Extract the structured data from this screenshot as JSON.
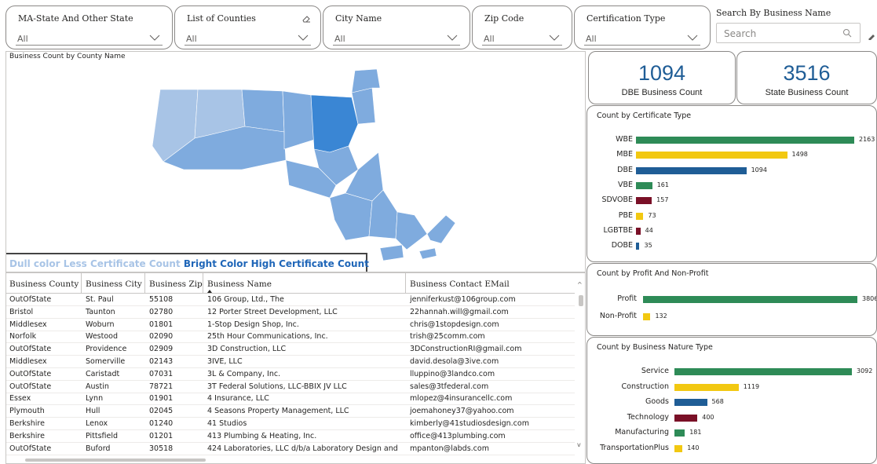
{
  "colors": {
    "green": "#2e8b57",
    "yellow": "#f2c811",
    "blue": "#1f5d96",
    "maroon": "#7a1027",
    "map_dull": "#a8c4e6",
    "map_mid": "#7fabde",
    "map_bright": "#3a86d4"
  },
  "slicers": [
    {
      "title": "MA-State And Other State",
      "value": "All"
    },
    {
      "title": "List of Counties",
      "value": "All"
    },
    {
      "title": "City Name",
      "value": "All"
    },
    {
      "title": "Zip Code",
      "value": "All"
    },
    {
      "title": "Certification Type",
      "value": "All"
    }
  ],
  "search": {
    "title": "Search By Business Name",
    "placeholder": "Search"
  },
  "map": {
    "title": "Business Count by County Name",
    "legend_dull": "Dull color Less Certificate Count",
    "legend_bright": "Bright Color High Certificate Count"
  },
  "table": {
    "columns": [
      "Business County",
      "Business City",
      "Business Zip",
      "Business Name",
      "Business Contact EMail"
    ],
    "rows": [
      [
        "OutOfState",
        "St. Paul",
        "55108",
        "106 Group, Ltd., The",
        "jenniferkust@106group.com"
      ],
      [
        "Bristol",
        "Taunton",
        "02780",
        "12 Porter Street Development, LLC",
        "22hannah.will@gmail.com"
      ],
      [
        "Middlesex",
        "Woburn",
        "01801",
        "1-Stop Design Shop, Inc.",
        "chris@1stopdesign.com"
      ],
      [
        "Norfolk",
        "Westood",
        "02090",
        "25th Hour Communications, Inc.",
        "trish@25comm.com"
      ],
      [
        "OutOfState",
        "Providence",
        "02909",
        "3D Construction, LLC",
        "3DConstructionRI@gmail.com"
      ],
      [
        "Middlesex",
        "Somerville",
        "02143",
        "3IVE, LLC",
        "david.desola@3ive.com"
      ],
      [
        "OutOfState",
        "Caristadt",
        "07031",
        "3L & Company, Inc.",
        "lluppino@3landco.com"
      ],
      [
        "OutOfState",
        "Austin",
        "78721",
        "3T Federal Solutions, LLC-BBIX JV LLC",
        "sales@3tfederal.com"
      ],
      [
        "Essex",
        "Lynn",
        "01901",
        "4 Insurance, LLC",
        "mlopez@4insurancellc.com"
      ],
      [
        "Plymouth",
        "Hull",
        "02045",
        "4 Seasons Property Management, LLC",
        "joemahoney37@yahoo.com"
      ],
      [
        "Berkshire",
        "Lenox",
        "01240",
        "41 Studios",
        "kimberly@41studiosdesign.com"
      ],
      [
        "Berkshire",
        "Pittsfield",
        "01201",
        "413 Plumbing & Heating, Inc.",
        "office@413plumbing.com"
      ],
      [
        "OutOfState",
        "Buford",
        "30518",
        "424 Laboratories, LLC d/b/a Laboratory Design and",
        "mpanton@labds.com"
      ]
    ]
  },
  "cards": [
    {
      "value": "1094",
      "label": "DBE Business Count"
    },
    {
      "value": "3516",
      "label": "State Business Count"
    }
  ],
  "chart_data": [
    {
      "type": "bar",
      "title": "Count by Certificate Type",
      "categories": [
        "WBE",
        "MBE",
        "DBE",
        "VBE",
        "SDVOBE",
        "PBE",
        "LGBTBE",
        "DOBE"
      ],
      "values": [
        2163,
        1498,
        1094,
        161,
        157,
        73,
        44,
        35
      ],
      "colors": [
        "green",
        "yellow",
        "blue",
        "green",
        "maroon",
        "yellow",
        "maroon",
        "blue"
      ]
    },
    {
      "type": "bar",
      "title": "Count by Profit And Non-Profit",
      "categories": [
        "Profit",
        "Non-Profit"
      ],
      "values": [
        3806,
        132
      ],
      "colors": [
        "green",
        "yellow"
      ]
    },
    {
      "type": "bar",
      "title": "Count by Business Nature Type",
      "categories": [
        "Service",
        "Construction",
        "Goods",
        "Technology",
        "Manufacturing",
        "TransportationPlus"
      ],
      "values": [
        3092,
        1119,
        568,
        400,
        181,
        140
      ],
      "colors": [
        "green",
        "yellow",
        "blue",
        "maroon",
        "green",
        "yellow"
      ]
    }
  ]
}
